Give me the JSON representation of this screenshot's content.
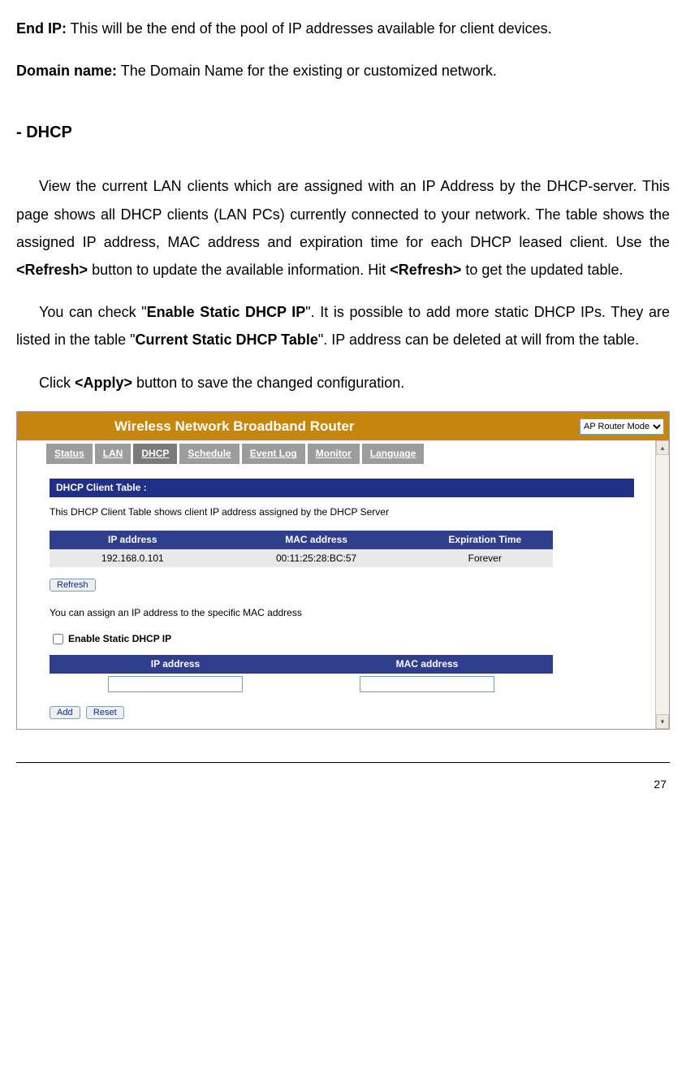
{
  "doc": {
    "endip_label": "End IP:",
    "endip_text": " This will be the end of the pool of IP addresses available for client devices.",
    "domain_label": "Domain name:",
    "domain_text": " The Domain Name for the existing or customized network.",
    "section_heading": "- DHCP",
    "p1_a": "View the current LAN clients which are assigned with an IP Address by the DHCP-server. This page shows all DHCP clients (LAN PCs) currently connected to your network. The table shows the assigned IP address, MAC address and expiration time for each DHCP leased client. Use the ",
    "p1_b": "<Refresh>",
    "p1_c": " button to update the available information. Hit ",
    "p1_d": "<Refresh>",
    "p1_e": " to get the updated table.",
    "p2_a": "You can check \"",
    "p2_b": "Enable Static DHCP IP",
    "p2_c": "\". It is possible to add more static DHCP IPs. They are listed in the table \"",
    "p2_d": "Current Static DHCP Table",
    "p2_e": "\". IP address can be deleted at will from the table.",
    "p3_a": "Click ",
    "p3_b": "<Apply>",
    "p3_c": " button to save the changed configuration.",
    "page_number": "27"
  },
  "router": {
    "title": "Wireless Network Broadband Router",
    "mode": "AP Router Mode",
    "nav": {
      "status": "Status",
      "lan": "LAN",
      "dhcp": "DHCP",
      "schedule": "Schedule",
      "eventlog": "Event Log",
      "monitor": "Monitor",
      "language": "Language"
    },
    "client_table_heading": "DHCP Client Table :",
    "client_table_desc": "This DHCP Client Table shows client IP address assigned by the DHCP Server",
    "cols": {
      "ip": "IP address",
      "mac": "MAC address",
      "exp": "Expiration Time"
    },
    "rows": [
      {
        "ip": "192.168.0.101",
        "mac": "00:11:25:28:BC:57",
        "exp": "Forever"
      }
    ],
    "refresh": "Refresh",
    "assign_text": "You can assign an IP address to the specific MAC address",
    "enable_static_label": "Enable Static DHCP IP",
    "static_cols": {
      "ip": "IP address",
      "mac": "MAC address"
    },
    "add": "Add",
    "reset": "Reset"
  }
}
